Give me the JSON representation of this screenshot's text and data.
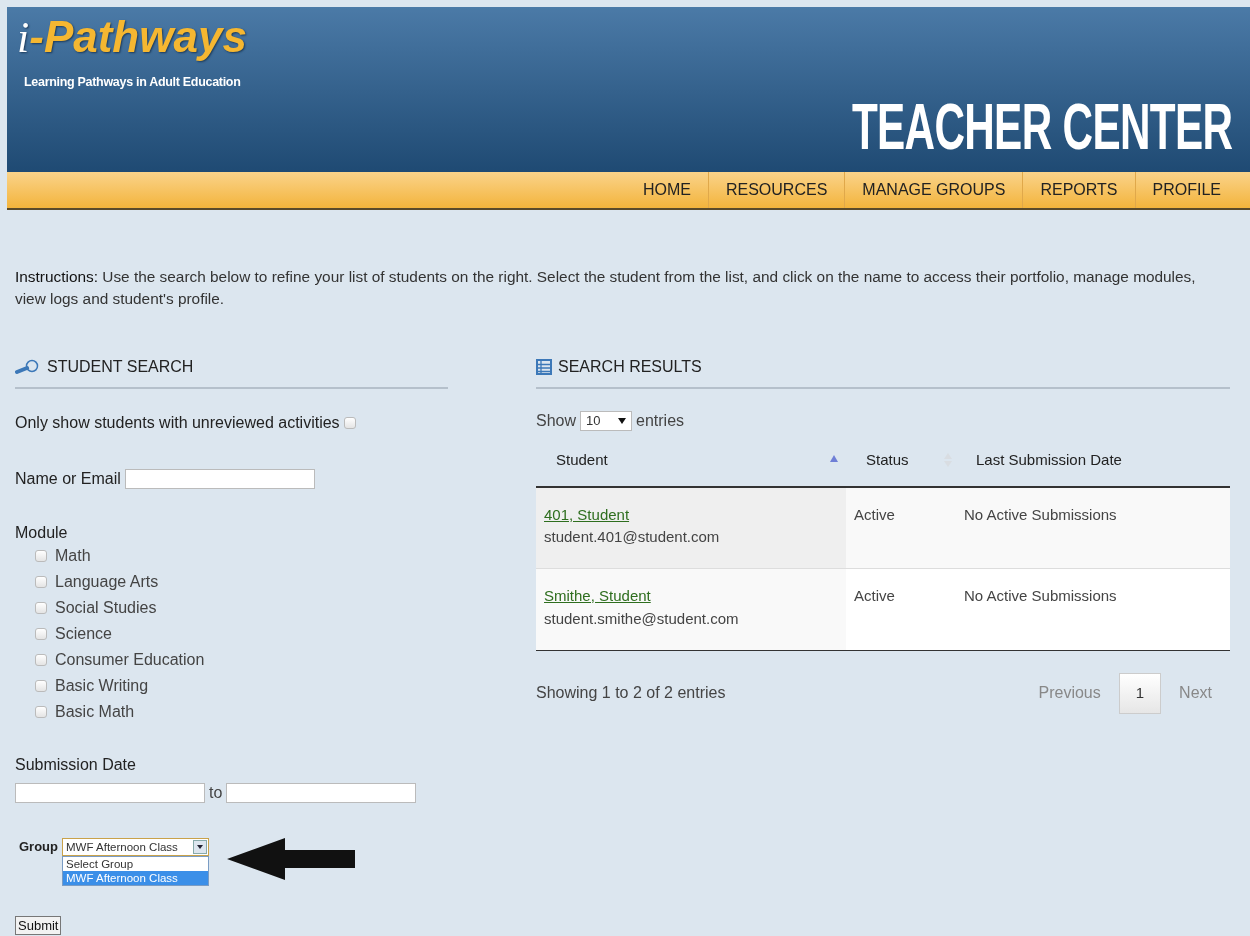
{
  "header": {
    "logo_mark": "i",
    "logo_name": "-Pathways",
    "tagline": "Learning Pathways in Adult Education",
    "title": "TEACHER CENTER"
  },
  "nav": [
    {
      "label": "HOME"
    },
    {
      "label": "RESOURCES"
    },
    {
      "label": "MANAGE GROUPS"
    },
    {
      "label": "REPORTS"
    },
    {
      "label": "PROFILE"
    }
  ],
  "instructions": "**Instructions:** Use the search below to refine your list of students on the right. Select the student from the list, and click on the name to access their portfolio, manage modules, view logs and student's profile.",
  "student_search": {
    "heading": "STUDENT SEARCH",
    "unreviewed_filter": {
      "label": "Only show students with unreviewed activities",
      "checked": false
    },
    "name_field": {
      "label": "Name or Email"
    },
    "module": {
      "label": "Module",
      "options": [
        {
          "label": "Math",
          "checked": false
        },
        {
          "label": "Language Arts",
          "checked": false
        },
        {
          "label": "Social Studies",
          "checked": false
        },
        {
          "label": "Science",
          "checked": false
        },
        {
          "label": "Consumer Education",
          "checked": false
        },
        {
          "label": "Basic Writing",
          "checked": false
        },
        {
          "label": "Basic Math",
          "checked": false
        }
      ]
    },
    "submission_date": {
      "label": "Submission Date",
      "separator": "to"
    },
    "group": {
      "label": "Group",
      "value": "MWF Afternoon Class",
      "expanded": true,
      "options": [
        {
          "label": "Select Group",
          "selected": false
        },
        {
          "label": "MWF Afternoon Class",
          "selected": true
        }
      ]
    },
    "submit": "Submit"
  },
  "search_results": {
    "heading": "SEARCH RESULTS",
    "length": {
      "prefix": "Show",
      "value": "10",
      "suffix": "entries"
    },
    "columns": [
      {
        "label": "Student",
        "sortable": true,
        "sorted": true
      },
      {
        "label": "Status",
        "sortable": true,
        "sorted": false
      },
      {
        "label": "Last Submission Date"
      }
    ],
    "rows": [
      {
        "name": "401, Student",
        "email": "student.401@student.com",
        "status": "Active",
        "last_submission": "No Active Submissions"
      },
      {
        "name": "Smithe, Student",
        "email": "student.smithe@student.com",
        "status": "Active",
        "last_submission": "No Active Submissions"
      }
    ],
    "info": "Showing 1 to 2 of 2 entries",
    "pagination": {
      "previous": "Previous",
      "pages": [
        {
          "label": "1",
          "selected": true
        }
      ],
      "next": "Next"
    }
  }
}
